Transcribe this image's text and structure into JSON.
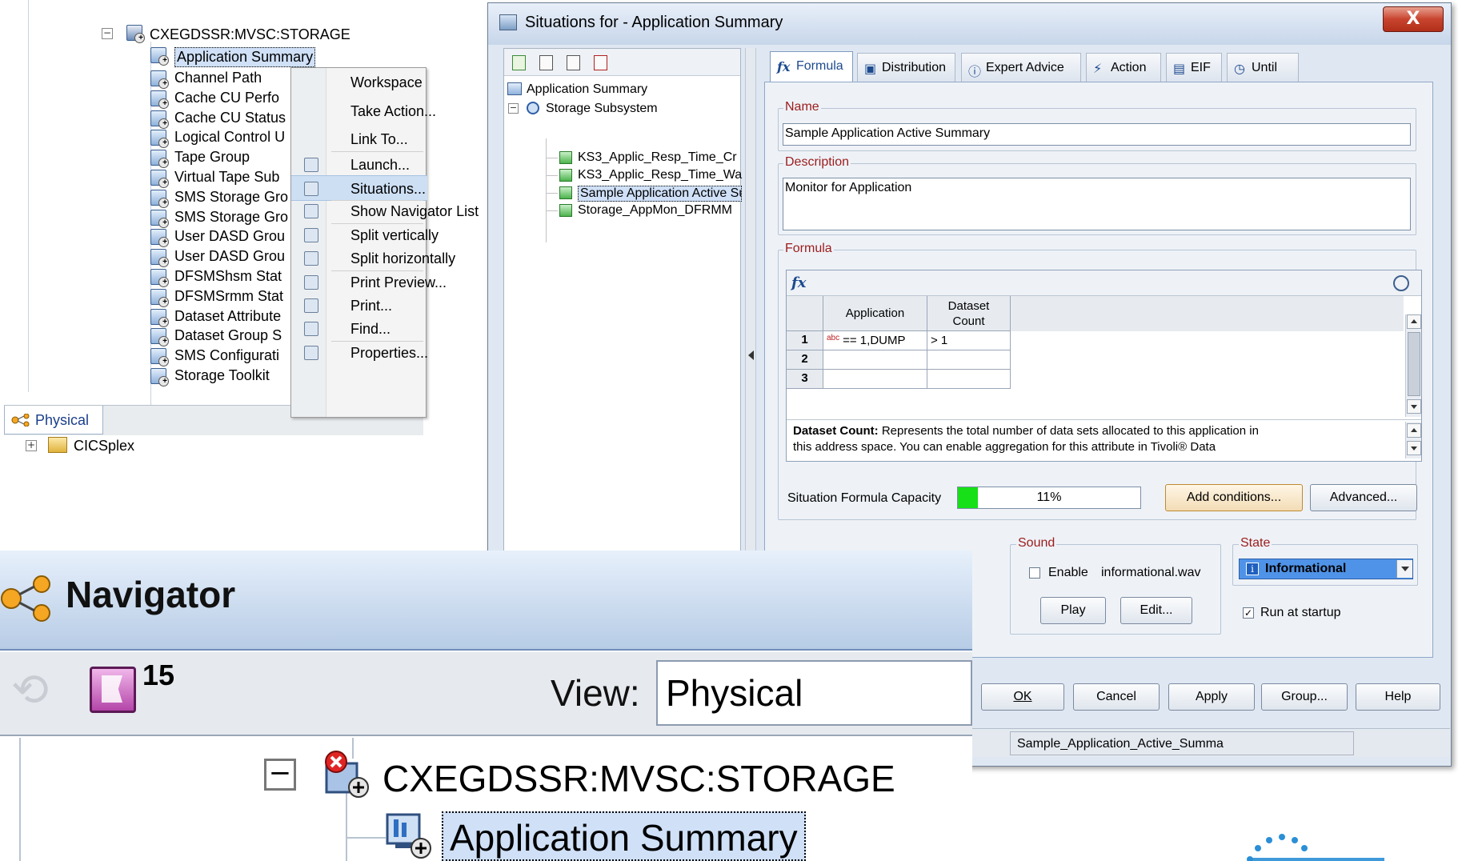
{
  "navigator_top": {
    "root_node": "CXEGDSSR:MVSC:STORAGE",
    "selected_item": "Application Summary",
    "items": [
      "Channel Path",
      "Cache CU Perfo",
      "Cache CU Status",
      "Logical Control U",
      "Tape Group",
      "Virtual Tape Sub",
      "SMS Storage Gro",
      "SMS Storage Gro",
      "User DASD Grou",
      "User DASD Grou",
      "DFSMShsm Stat",
      "DFSMSrmm Stat",
      "Dataset Attribute",
      "Dataset Group S",
      "SMS Configurati",
      "Storage Toolkit"
    ],
    "sibling_node": "CICSplex",
    "bottom_tab": "Physical"
  },
  "context_menu": {
    "items": [
      {
        "label": "Workspace",
        "icon": "",
        "highlighted": false
      },
      {
        "label": "Take Action...",
        "icon": "",
        "highlighted": false
      },
      {
        "label": "Link To...",
        "icon": "",
        "highlighted": false
      },
      {
        "label": "Launch...",
        "icon": "launch-icon",
        "highlighted": false
      },
      {
        "label": "Situations...",
        "icon": "situations-icon",
        "highlighted": true
      },
      {
        "label": "Show Navigator List",
        "icon": "navigator-list-icon",
        "highlighted": false
      },
      {
        "label": "Split vertically",
        "icon": "split-vertical-icon",
        "highlighted": false
      },
      {
        "label": "Split horizontally",
        "icon": "split-horizontal-icon",
        "highlighted": false
      },
      {
        "label": "Print Preview...",
        "icon": "print-preview-icon",
        "highlighted": false
      },
      {
        "label": "Print...",
        "icon": "print-icon",
        "highlighted": false
      },
      {
        "label": "Find...",
        "icon": "find-icon",
        "highlighted": false
      },
      {
        "label": "Properties...",
        "icon": "properties-icon",
        "highlighted": false
      }
    ]
  },
  "dialog": {
    "title": "Situations for - Application Summary",
    "close_label": "X",
    "tree": {
      "root": "Application Summary",
      "subsystem": "Storage Subsystem",
      "situations": [
        {
          "label": "KS3_Applic_Resp_Time_Cr",
          "selected": false
        },
        {
          "label": "KS3_Applic_Resp_Time_Wa",
          "selected": false
        },
        {
          "label": "Sample Application Active Su",
          "selected": true
        },
        {
          "label": "Storage_AppMon_DFRMM",
          "selected": false
        }
      ]
    },
    "tabs": [
      {
        "label": "Formula",
        "icon": "fx",
        "active": true
      },
      {
        "label": "Distribution",
        "icon": "▣",
        "active": false
      },
      {
        "label": "Expert Advice",
        "icon": "ⓘ",
        "active": false
      },
      {
        "label": "Action",
        "icon": "⚡",
        "active": false
      },
      {
        "label": "EIF",
        "icon": "▤",
        "active": false
      },
      {
        "label": "Until",
        "icon": "◷",
        "active": false
      }
    ],
    "name_group": {
      "title": "Name",
      "value": "Sample Application Active Summary"
    },
    "description_group": {
      "title": "Description",
      "value": "Monitor for Application"
    },
    "formula_group": {
      "title": "Formula",
      "fx_label": "fx",
      "columns": [
        "Application",
        "Dataset Count"
      ],
      "column_1_line1": "Dataset",
      "column_1_line2": "Count",
      "rows": [
        {
          "num": "1",
          "application": "== 1,DUMP",
          "dataset_count": "> 1"
        },
        {
          "num": "2",
          "application": "",
          "dataset_count": ""
        },
        {
          "num": "3",
          "application": "",
          "dataset_count": ""
        }
      ],
      "help_term": "Dataset Count:",
      "help_line1": "Represents the total number of data sets allocated to this application in",
      "help_line2": "this address space. You can enable aggregation for this attribute in Tivoli® Data"
    },
    "capacity": {
      "label": "Situation Formula Capacity",
      "percent_text": "11%",
      "fraction": 0.11,
      "fill_color": "#18e018"
    },
    "buttons_formula": {
      "add_conditions": "Add conditions...",
      "advanced": "Advanced..."
    },
    "sound_group": {
      "title": "Sound",
      "enable_label": "Enable",
      "file": "informational.wav",
      "play": "Play",
      "edit": "Edit...",
      "enabled": false
    },
    "state_group": {
      "title": "State",
      "value": "Informational",
      "run_at_startup_label": "Run at startup",
      "run_at_startup": true
    },
    "footer_buttons": {
      "ok": "OK",
      "cancel": "Cancel",
      "apply": "Apply",
      "group": "Group...",
      "help": "Help"
    },
    "status_text": "Sample_Application_Active_Summa"
  },
  "zoom_navigator": {
    "title": "Navigator",
    "event_count": "15",
    "view_label": "View:",
    "view_value": "Physical",
    "root_node": "CXEGDSSR:MVSC:STORAGE",
    "selected_item": "Application Summary"
  },
  "colors": {
    "selection_bg": "#cfe0f7",
    "group_title": "#9b1c1c",
    "close_button": "#c8442e",
    "share_logo": "#2b8fd6"
  }
}
